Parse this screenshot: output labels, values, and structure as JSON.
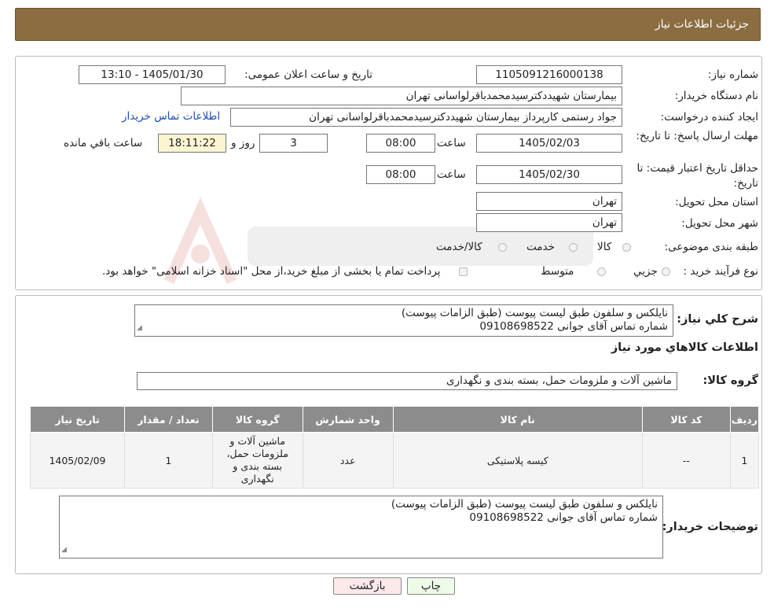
{
  "header": {
    "title": "جزئیات اطلاعات نیاز"
  },
  "form": {
    "need_number_label": "شماره نیاز:",
    "need_number": "1105091216000138",
    "announce_label": "تاریخ و ساعت اعلان عمومی:",
    "announce_value": "1405/01/30 - 13:10",
    "buyer_org_label": "نام دستگاه خریدار:",
    "buyer_org": "بیمارستان شهیددکترسیدمحمدباقرلواسانی تهران",
    "creator_label": "ایجاد کننده درخواست:",
    "creator": "جواد رستمی کارپرداز بیمارستان شهیددکترسیدمحمدباقرلواسانی تهران",
    "contact_link": "اطلاعات تماس خریدار",
    "reply_deadline_label": "مهلت ارسال پاسخ: تا تاریخ:",
    "reply_date": "1405/02/03",
    "time_label": "ساعت",
    "reply_time": "08:00",
    "days": "3",
    "days_label": "روز و",
    "remaining_time": "18:11:22",
    "remaining_label": "ساعت باقي مانده",
    "price_valid_label": "حداقل تاریخ اعتبار قیمت: تا تاریخ:",
    "price_date": "1405/02/30",
    "price_time": "08:00",
    "province_label": "استان محل تحویل:",
    "province": "تهران",
    "city_label": "شهر محل تحویل:",
    "city": "تهران",
    "category_label": "طبقه بندی موضوعی:",
    "category_opts": [
      "کالا",
      "خدمت",
      "کالا/خدمت"
    ],
    "process_label": "نوع فرآیند خرید :",
    "process_opts": [
      "جزیي",
      "متوسط"
    ],
    "payment_note": "پرداخت تمام یا بخشی از مبلغ خرید،از محل \"اسناد خزانه اسلامی\" خواهد بود."
  },
  "desc": {
    "label": "شرح كلي نياز:",
    "line1": "نایلکس و سلفون طبق لیست پیوست (طبق الزامات پیوست)",
    "line2": "شماره تماس آقای جوانی 09108698522"
  },
  "items_section": {
    "title": "اطلاعات كالاهاي مورد نياز",
    "group_label": "گروه کالا:",
    "group_value": "ماشین آلات و ملزومات حمل، بسته بندی و نگهداری"
  },
  "table": {
    "headers": [
      "ردیف",
      "کد کالا",
      "نام کالا",
      "واحد شمارش",
      "گروه کالا",
      "تعداد / مقدار",
      "تاریخ نیاز"
    ],
    "row": {
      "idx": "1",
      "code": "--",
      "name": "کیسه پلاستیکی",
      "unit": "عدد",
      "group": "ماشین آلات و ملزومات حمل، بسته بندی و نگهداری",
      "qty": "1",
      "date": "1405/02/09"
    }
  },
  "buyer_notes": {
    "label": "توضیحات خریدار:",
    "line1": "نایلکس و سلفون طبق لیست پیوست (طبق الزامات پیوست)",
    "line2": "شماره تماس آقای جوانی 09108698522"
  },
  "buttons": {
    "print": "چاپ",
    "back": "بازگشت"
  },
  "colors": {
    "header_bg": "#8b6d41",
    "table_header": "#8c8c8c",
    "remaining_bg": "#fdf5d2",
    "link": "#1a4fb3"
  }
}
